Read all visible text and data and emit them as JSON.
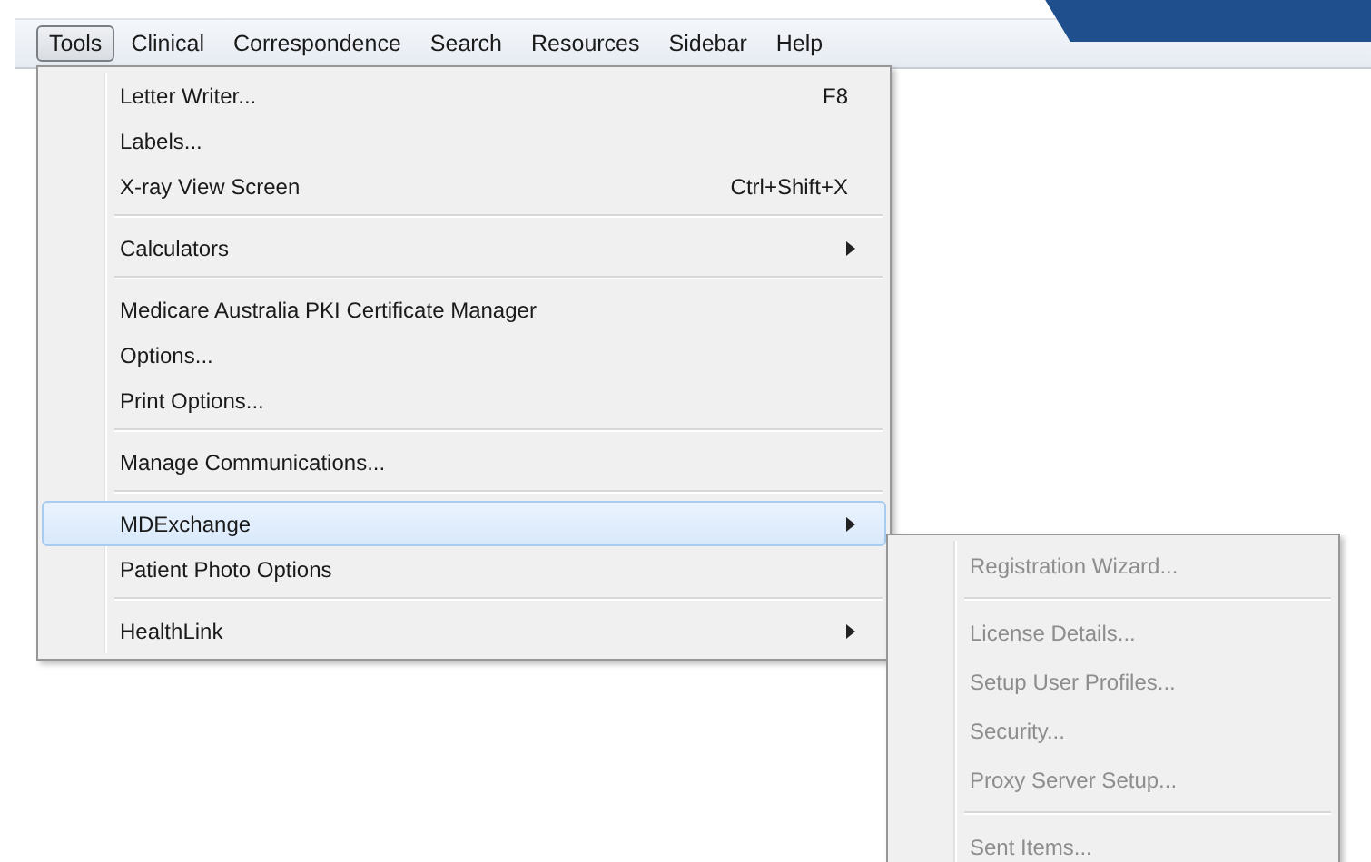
{
  "menubar": [
    {
      "label": "Tools",
      "selected": true
    },
    {
      "label": "Clinical",
      "selected": false
    },
    {
      "label": "Correspondence",
      "selected": false
    },
    {
      "label": "Search",
      "selected": false
    },
    {
      "label": "Resources",
      "selected": false
    },
    {
      "label": "Sidebar",
      "selected": false
    },
    {
      "label": "Help",
      "selected": false
    }
  ],
  "menu": [
    {
      "kind": "item",
      "label": "Letter Writer...",
      "shortcut": "F8",
      "submenu": false,
      "selected": false
    },
    {
      "kind": "item",
      "label": "Labels...",
      "submenu": false,
      "selected": false
    },
    {
      "kind": "item",
      "label": "X-ray View Screen",
      "shortcut": "Ctrl+Shift+X",
      "submenu": false,
      "selected": false
    },
    {
      "kind": "separator"
    },
    {
      "kind": "item",
      "label": "Calculators",
      "submenu": true,
      "selected": false
    },
    {
      "kind": "separator"
    },
    {
      "kind": "item",
      "label": "Medicare Australia PKI Certificate Manager",
      "submenu": false,
      "selected": false
    },
    {
      "kind": "item",
      "label": "Options...",
      "submenu": false,
      "selected": false
    },
    {
      "kind": "item",
      "label": "Print Options...",
      "submenu": false,
      "selected": false
    },
    {
      "kind": "separator"
    },
    {
      "kind": "item",
      "label": "Manage Communications...",
      "submenu": false,
      "selected": false
    },
    {
      "kind": "separator"
    },
    {
      "kind": "item",
      "label": "MDExchange",
      "submenu": true,
      "selected": true
    },
    {
      "kind": "item",
      "label": "Patient Photo Options",
      "submenu": false,
      "selected": false
    },
    {
      "kind": "separator"
    },
    {
      "kind": "item",
      "label": "HealthLink",
      "submenu": true,
      "selected": false
    }
  ],
  "submenu": [
    {
      "kind": "item",
      "label": "Registration Wizard...",
      "disabled": true
    },
    {
      "kind": "separator"
    },
    {
      "kind": "item",
      "label": "License Details...",
      "disabled": true
    },
    {
      "kind": "item",
      "label": "Setup User Profiles...",
      "disabled": true
    },
    {
      "kind": "item",
      "label": "Security...",
      "disabled": true
    },
    {
      "kind": "item",
      "label": "Proxy Server Setup...",
      "disabled": true
    },
    {
      "kind": "separator"
    },
    {
      "kind": "item",
      "label": "Sent Items...",
      "disabled": true
    }
  ]
}
